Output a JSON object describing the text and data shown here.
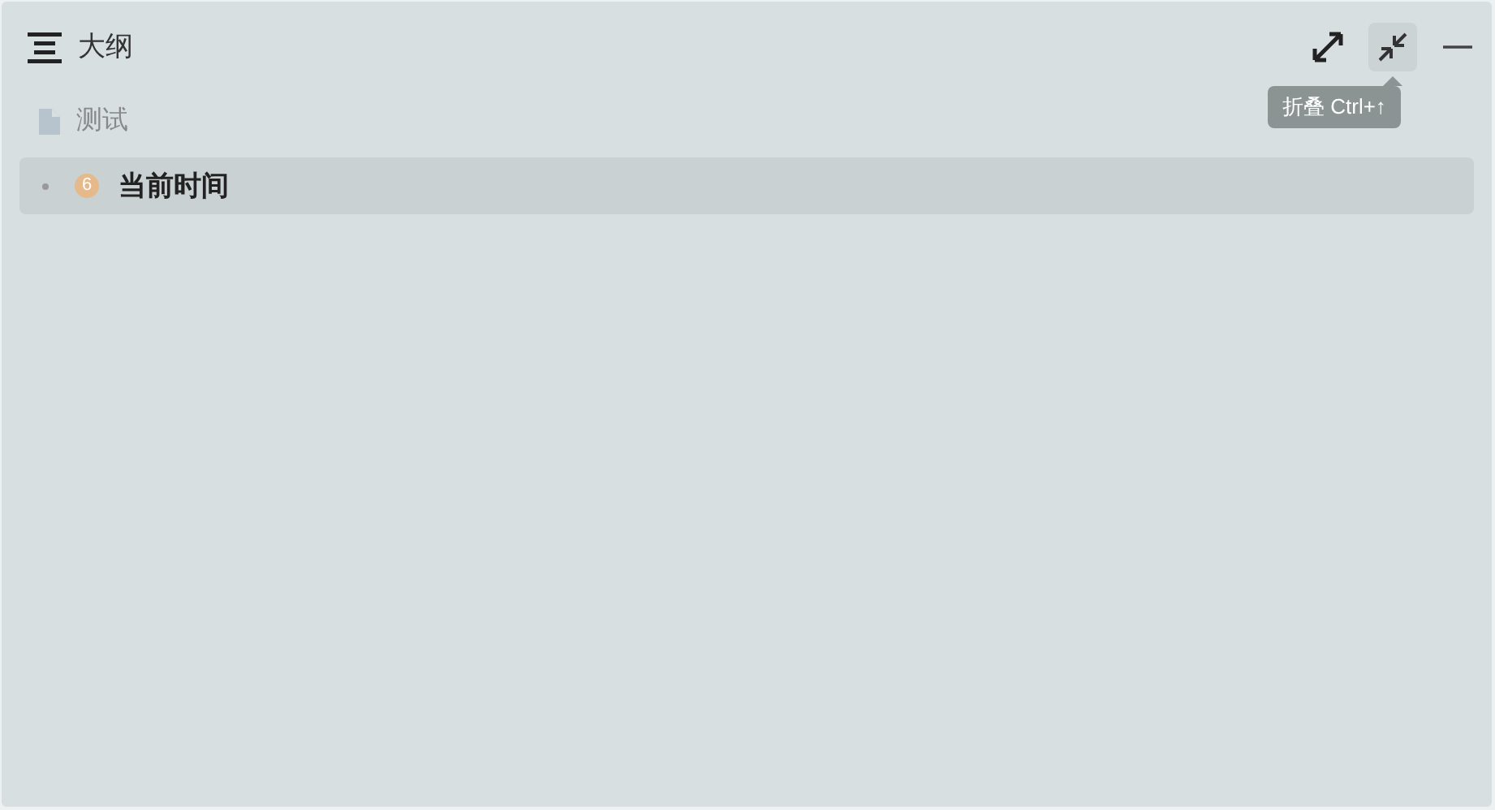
{
  "panel": {
    "title": "大纲"
  },
  "toolbar": [
    {
      "kind": "expand",
      "hovered": false
    },
    {
      "kind": "collapse",
      "hovered": true
    },
    {
      "kind": "minimize",
      "hovered": false
    }
  ],
  "tooltip": {
    "text": "折叠 Ctrl+↑"
  },
  "items": [
    {
      "kind": "document",
      "label": "测试",
      "selected": false
    },
    {
      "kind": "heading",
      "badge": "6",
      "label": "当前时间",
      "selected": true
    }
  ]
}
